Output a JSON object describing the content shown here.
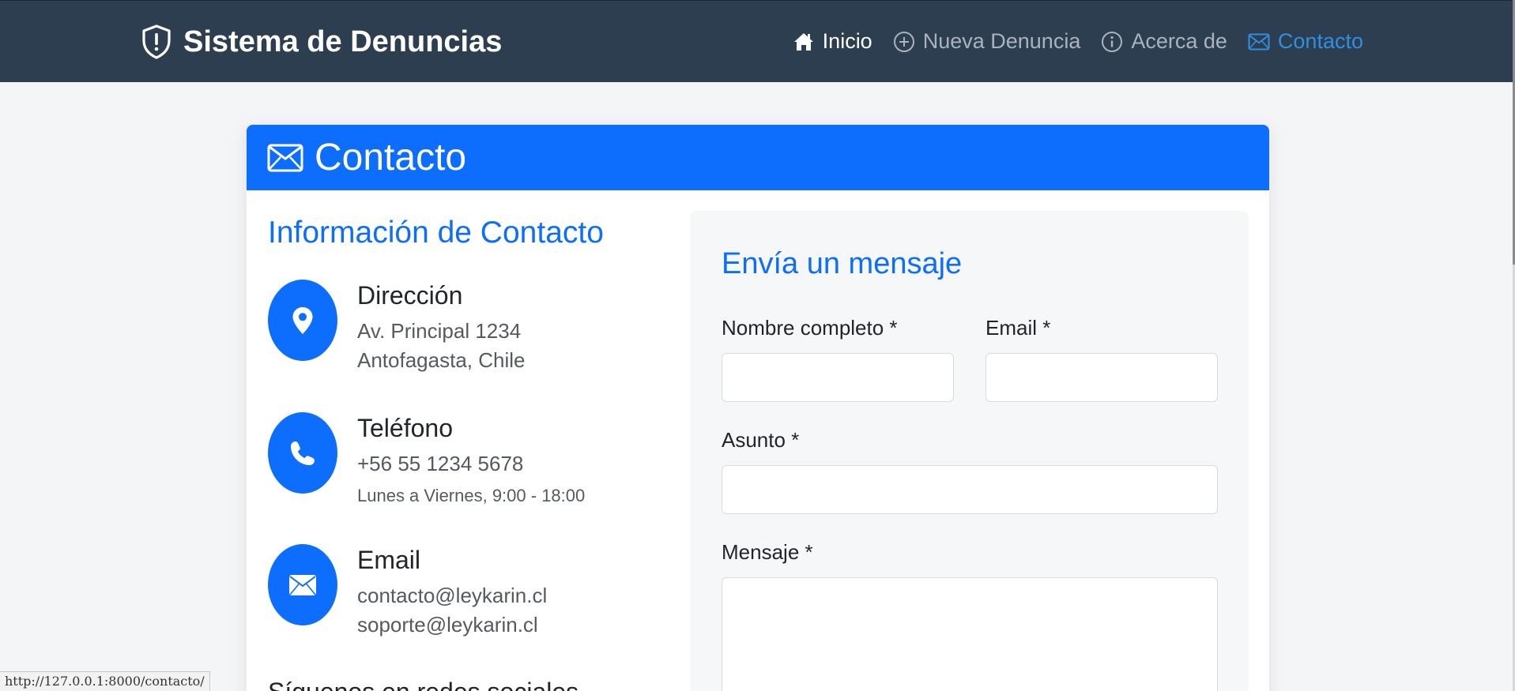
{
  "navbar": {
    "brand": "Sistema de Denuncias",
    "items": [
      {
        "label": "Inicio",
        "icon": "home-icon"
      },
      {
        "label": "Nueva Denuncia",
        "icon": "plus-circle-icon"
      },
      {
        "label": "Acerca de",
        "icon": "info-circle-icon"
      },
      {
        "label": "Contacto",
        "icon": "envelope-icon",
        "active": true
      }
    ]
  },
  "card": {
    "header_title": "Contacto"
  },
  "info": {
    "title": "Información de Contacto",
    "direccion": {
      "heading": "Dirección",
      "line1": "Av. Principal 1234",
      "line2": "Antofagasta, Chile"
    },
    "telefono": {
      "heading": "Teléfono",
      "line1": "+56 55 1234 5678",
      "line2": "Lunes a Viernes, 9:00 - 18:00"
    },
    "email": {
      "heading": "Email",
      "line1": "contacto@leykarin.cl",
      "line2": "soporte@leykarin.cl"
    },
    "social_title": "Síguenos en redes sociales"
  },
  "form": {
    "title": "Envía un mensaje",
    "nombre_label": "Nombre completo *",
    "nombre_value": "",
    "email_label": "Email *",
    "email_value": "",
    "asunto_label": "Asunto *",
    "asunto_value": "",
    "mensaje_label": "Mensaje *",
    "mensaje_value": ""
  },
  "statusbar": {
    "url": "http://127.0.0.1:8000/contacto/"
  },
  "colors": {
    "navbar_bg": "#2d3e50",
    "primary": "#0d6efd",
    "nav_active": "#2f8fe0",
    "page_bg": "#f4f5f7"
  }
}
